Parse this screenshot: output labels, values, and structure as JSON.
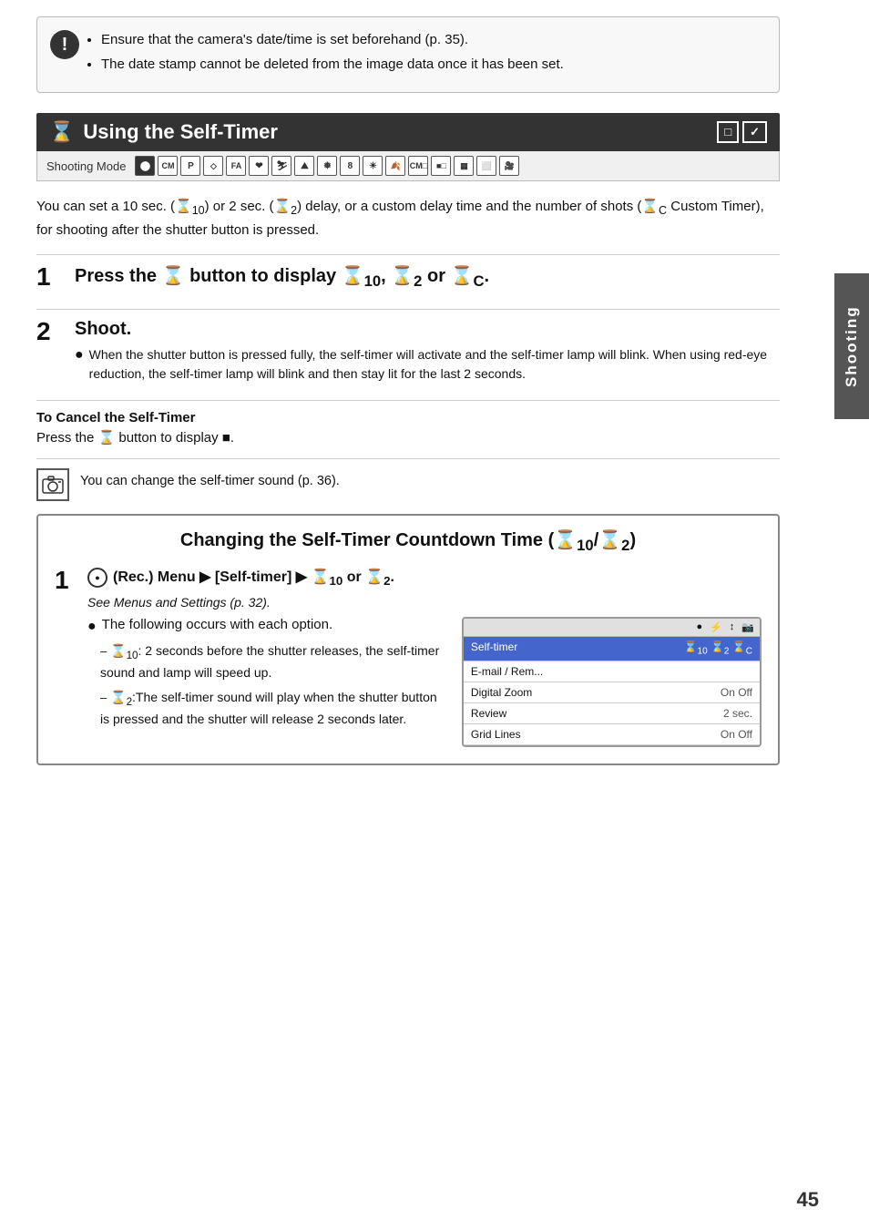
{
  "warning": {
    "bullet1": "Ensure that the camera's date/time is set beforehand (p. 35).",
    "bullet2": "The date stamp cannot be deleted from the image data once it has been set."
  },
  "section": {
    "title": "Using the Self-Timer",
    "icon1": "⬜",
    "icon2": "🔲",
    "shooting_mode_label": "Shooting Mode"
  },
  "body_text": "You can set a 10 sec. (  ) or 2 sec. (  ) delay, or a custom delay time and the number of shots (  Custom Timer), for shooting after the shutter button is pressed.",
  "step1": {
    "number": "1",
    "title_prefix": "Press the",
    "title_mid": "button to display",
    "title_suffix": ",      or     ."
  },
  "step2": {
    "number": "2",
    "title": "Shoot.",
    "body": "When the shutter button is pressed fully, the self-timer will activate and the self-timer lamp will blink. When using red-eye reduction, the self-timer lamp will blink and then stay lit for the last 2 seconds."
  },
  "cancel_section": {
    "title": "To Cancel the Self-Timer",
    "body": "Press the      button to display      ."
  },
  "note": {
    "text": "You can change the self-timer sound (p. 36)."
  },
  "countdown": {
    "box_title": "Changing the Self-Timer Countdown Time (📷/📷)",
    "box_title_clean": "Changing the Self-Timer Countdown Time",
    "step1_header": "(Rec.) Menu ▶ [Self-timer] ▶       or      .",
    "see_text": "See Menus and Settings (p. 32).",
    "bullet_main": "The following occurs with each option.",
    "option1_label": "c10",
    "option1_text": ": 2 seconds before the shutter releases, the self-timer sound and lamp will speed up.",
    "option2_text": ":The self-timer sound will play when the shutter button is pressed and the shutter will release 2 seconds later.",
    "menu": {
      "top_icons": [
        "⬤",
        "⚡",
        "↕",
        "📷"
      ],
      "rows": [
        {
          "label": "Self-timer",
          "value": "c10 c2 cc",
          "highlighted": true
        },
        {
          "label": "E-mail / Rem...",
          "value": ""
        },
        {
          "label": "Digital Zoom",
          "value": "On  Off"
        },
        {
          "label": "Review",
          "value": "2 sec."
        },
        {
          "label": "Grid Lines",
          "value": "On  Off"
        }
      ]
    }
  },
  "page_number": "45",
  "side_tab_text": "Shooting"
}
